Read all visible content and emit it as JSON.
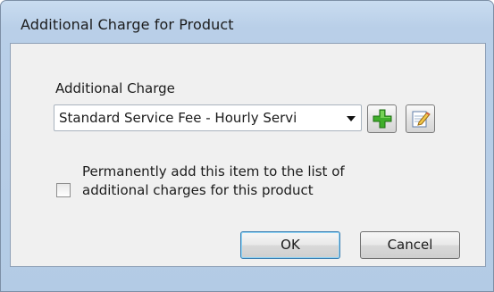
{
  "window": {
    "title": "Additional Charge for Product"
  },
  "form": {
    "charge_label": "Additional Charge",
    "charge_selected": "Standard Service Fee - Hourly Servi",
    "add_icon": "plus-icon",
    "edit_icon": "edit-note-icon",
    "permanent_checked": false,
    "permanent_label_line1": "Permanently add this item to the list of",
    "permanent_label_line2": "additional charges for this product"
  },
  "buttons": {
    "ok_label": "OK",
    "cancel_label": "Cancel"
  },
  "colors": {
    "title_bar": "#b9cfe8",
    "client_bg": "#f0f0f0",
    "default_button_border": "#3c7fb1",
    "add_icon_green": "#3fae2a"
  }
}
